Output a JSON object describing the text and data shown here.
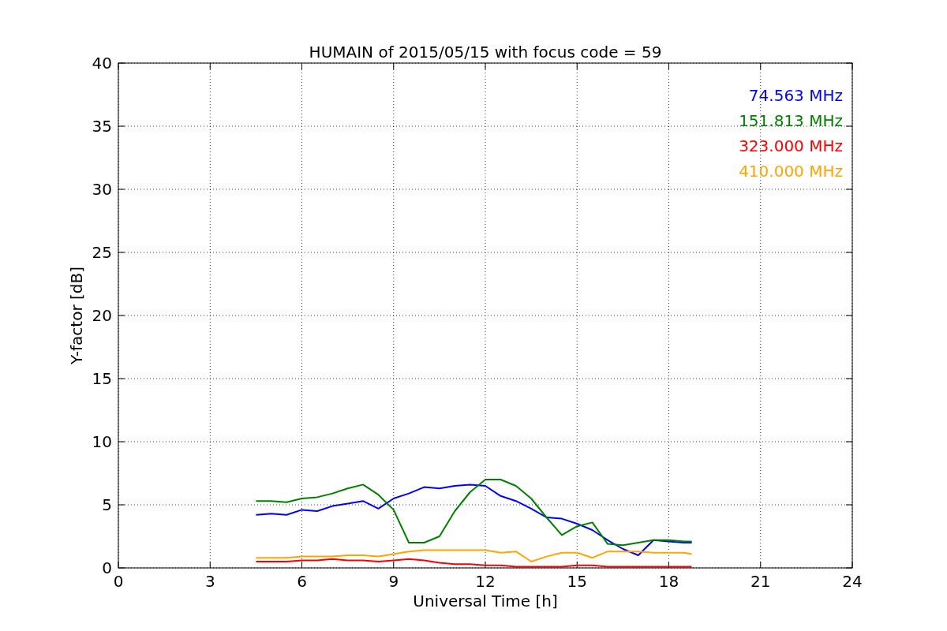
{
  "figure": {
    "chart_data": {
      "type": "line",
      "title": "HUMAIN of 2015/05/15 with focus code = 59",
      "xlabel": "Universal Time [h]",
      "ylabel": "Y-factor [dB]",
      "x": [
        4.5,
        5,
        5.5,
        6,
        6.5,
        7,
        7.5,
        8,
        8.5,
        9,
        9.5,
        10,
        10.5,
        11,
        11.5,
        12,
        12.5,
        13,
        13.5,
        14,
        14.5,
        15,
        15.5,
        16,
        16.5,
        17,
        17.5,
        18,
        18.5,
        18.75
      ],
      "series": [
        {
          "name": "74.563 MHz",
          "color": "#0000ff",
          "values": [
            4.2,
            4.3,
            4.2,
            4.6,
            4.5,
            4.9,
            5.1,
            5.3,
            4.7,
            5.5,
            5.9,
            6.4,
            6.3,
            6.5,
            6.6,
            6.5,
            5.7,
            5.3,
            4.7,
            4.0,
            3.9,
            3.5,
            3.0,
            2.2,
            1.5,
            1.0,
            2.2,
            2.1,
            2.0,
            2.0
          ]
        },
        {
          "name": "151.813 MHz",
          "color": "#008000",
          "values": [
            5.3,
            5.3,
            5.2,
            5.5,
            5.6,
            5.9,
            6.3,
            6.6,
            5.8,
            4.6,
            2.0,
            2.0,
            2.5,
            4.5,
            6.0,
            7.0,
            7.0,
            6.5,
            5.5,
            4.0,
            2.6,
            3.3,
            3.6,
            1.9,
            1.8,
            2.0,
            2.2,
            2.2,
            2.1,
            2.1
          ]
        },
        {
          "name": "323.000 MHz",
          "color": "#ff0000",
          "values": [
            0.5,
            0.5,
            0.5,
            0.6,
            0.6,
            0.7,
            0.6,
            0.6,
            0.5,
            0.6,
            0.7,
            0.6,
            0.4,
            0.3,
            0.3,
            0.2,
            0.2,
            0.1,
            0.1,
            0.1,
            0.1,
            0.2,
            0.2,
            0.1,
            0.1,
            0.1,
            0.1,
            0.1,
            0.1,
            0.1
          ]
        },
        {
          "name": "410.000 MHz",
          "color": "#ffa500",
          "values": [
            0.8,
            0.8,
            0.8,
            0.9,
            0.9,
            0.9,
            1.0,
            1.0,
            0.9,
            1.1,
            1.3,
            1.4,
            1.4,
            1.4,
            1.4,
            1.4,
            1.2,
            1.3,
            0.5,
            0.9,
            1.2,
            1.2,
            0.8,
            1.3,
            1.3,
            1.3,
            1.2,
            1.2,
            1.2,
            1.1
          ]
        }
      ],
      "xlim": [
        0,
        24
      ],
      "ylim": [
        0,
        40
      ],
      "grid": true,
      "xticks": [
        0,
        3,
        6,
        9,
        12,
        15,
        18,
        21,
        24
      ],
      "yticks": [
        0,
        5,
        10,
        15,
        20,
        25,
        30,
        35,
        40
      ]
    }
  }
}
